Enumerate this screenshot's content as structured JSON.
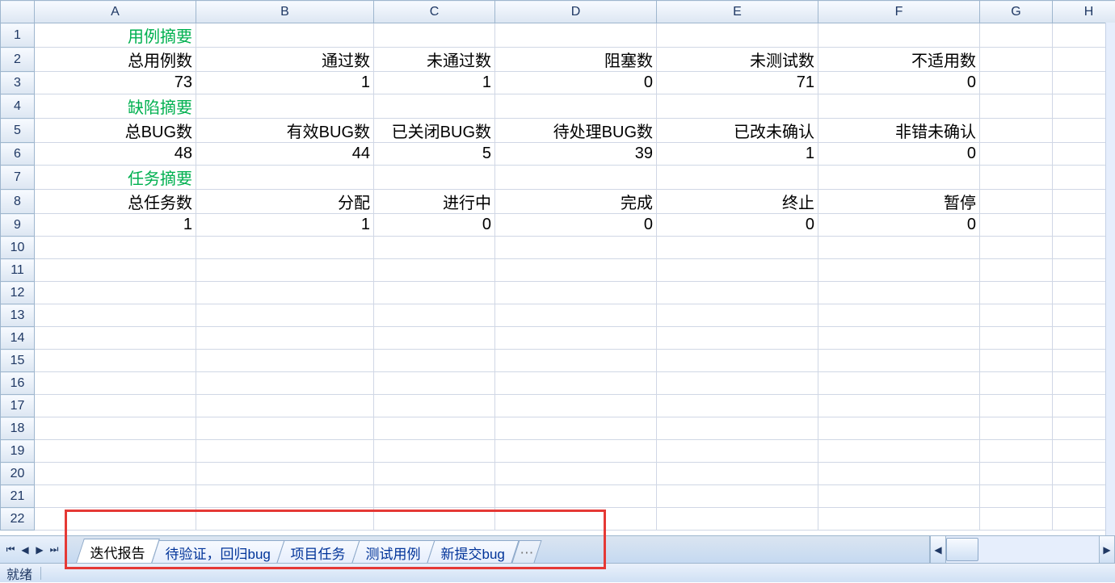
{
  "columns": [
    "A",
    "B",
    "C",
    "D",
    "E",
    "F",
    "G",
    "H"
  ],
  "row_count": 22,
  "cells": {
    "r1": {
      "A": {
        "v": "用例摘要",
        "green": true
      }
    },
    "r2": {
      "A": {
        "v": "总用例数"
      },
      "B": {
        "v": "通过数"
      },
      "C": {
        "v": "未通过数"
      },
      "D": {
        "v": "阻塞数"
      },
      "E": {
        "v": "未测试数"
      },
      "F": {
        "v": "不适用数"
      }
    },
    "r3": {
      "A": {
        "v": "73"
      },
      "B": {
        "v": "1"
      },
      "C": {
        "v": "1"
      },
      "D": {
        "v": "0"
      },
      "E": {
        "v": "71"
      },
      "F": {
        "v": "0"
      }
    },
    "r4": {
      "A": {
        "v": "缺陷摘要",
        "green": true
      }
    },
    "r5": {
      "A": {
        "v": "总BUG数"
      },
      "B": {
        "v": "有效BUG数"
      },
      "C": {
        "v": "已关闭BUG数"
      },
      "D": {
        "v": "待处理BUG数"
      },
      "E": {
        "v": "已改未确认"
      },
      "F": {
        "v": "非错未确认"
      }
    },
    "r6": {
      "A": {
        "v": "48"
      },
      "B": {
        "v": "44"
      },
      "C": {
        "v": "5"
      },
      "D": {
        "v": "39"
      },
      "E": {
        "v": "1"
      },
      "F": {
        "v": "0"
      }
    },
    "r7": {
      "A": {
        "v": "任务摘要",
        "green": true
      }
    },
    "r8": {
      "A": {
        "v": "总任务数"
      },
      "B": {
        "v": "分配"
      },
      "C": {
        "v": "进行中"
      },
      "D": {
        "v": "完成"
      },
      "E": {
        "v": "终止"
      },
      "F": {
        "v": "暂停"
      }
    },
    "r9": {
      "A": {
        "v": "1"
      },
      "B": {
        "v": "1"
      },
      "C": {
        "v": "0"
      },
      "D": {
        "v": "0"
      },
      "E": {
        "v": "0"
      },
      "F": {
        "v": "0"
      }
    }
  },
  "sheet_tabs": [
    {
      "label": "迭代报告",
      "active": true
    },
    {
      "label": "待验证，回归bug",
      "active": false
    },
    {
      "label": "项目任务",
      "active": false
    },
    {
      "label": "测试用例",
      "active": false
    },
    {
      "label": "新提交bug",
      "active": false
    }
  ],
  "status_text": "就绪",
  "nav_icons": {
    "first": "⏮",
    "prev": "◀",
    "next": "▶",
    "last": "⏭"
  },
  "newtab_icon": "⋯",
  "scroll_icons": {
    "left": "◀",
    "right": "▶"
  }
}
